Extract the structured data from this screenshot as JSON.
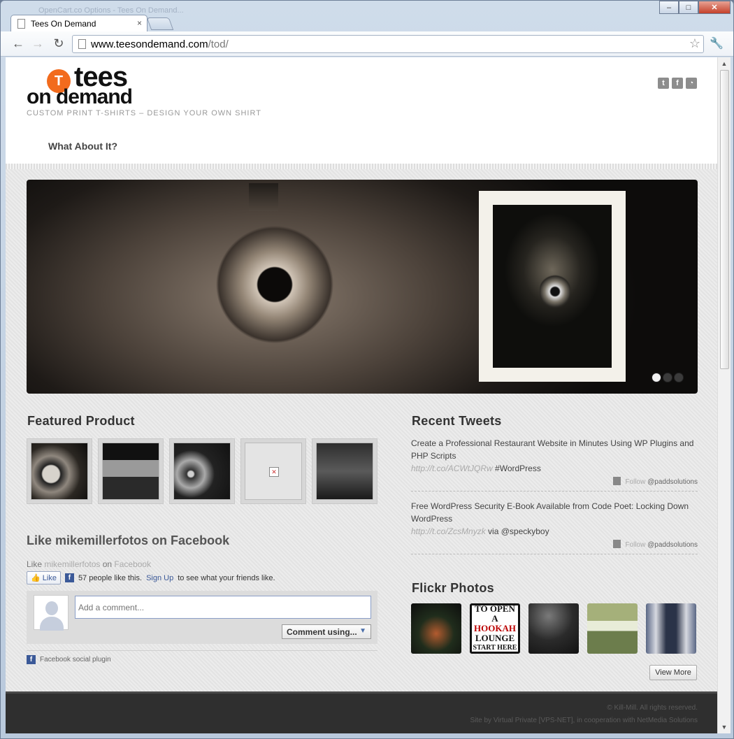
{
  "browser": {
    "ghost_tab_label": "OpenCart.co Options - Tees On Demand...",
    "tab_title": "Tees On Demand",
    "tab_close": "×",
    "url_host": "www.teesondemand.com",
    "url_path": "/tod/",
    "window_buttons": {
      "minimize": "–",
      "maximize": "□",
      "close": "✕"
    }
  },
  "site": {
    "logo_letter": "T",
    "logo_word1": "tees",
    "logo_word2": "on demand",
    "tagline": "CUSTOM PRINT T-SHIRTS – DESIGN YOUR OWN SHIRT",
    "social_icons": [
      "twitter-icon",
      "facebook-icon",
      "rss-icon"
    ],
    "social_glyphs": [
      "t",
      "f",
      "◔"
    ],
    "nav": {
      "about": "What About It?"
    }
  },
  "slider": {
    "dots_count": 3,
    "active_dot": 0
  },
  "featured": {
    "title": "Featured Product"
  },
  "facebook": {
    "title": "Like mikemillerfotos on Facebook",
    "like_prefix": "Like ",
    "page_link": "mikemillerfotos",
    "like_on": " on ",
    "fb_link": "Facebook",
    "like_button": "👍 Like",
    "count_text": "57 people like this.",
    "signup": "Sign Up",
    "signup_suffix": "to see what your friends like.",
    "comment_placeholder": "Add a comment...",
    "comment_using": "Comment using...",
    "plugin_label": "Facebook social plugin"
  },
  "tweets": {
    "title": "Recent Tweets",
    "items": [
      {
        "text": "Create a Professional Restaurant Website in Minutes Using WP Plugins and PHP Scripts",
        "url": "http://t.co/ACWtJQRw",
        "suffix": " #WordPress",
        "follow": "Follow",
        "handle": "@paddsolutions"
      },
      {
        "text": "Free WordPress Security E-Book Available from Code Poet: Locking Down WordPress",
        "url": "http://t.co/ZcsMnyzk",
        "suffix": " via @speckyboy",
        "follow": "Follow",
        "handle": "@paddsolutions"
      }
    ]
  },
  "flickr": {
    "title": "Flickr Photos",
    "sign_lines": [
      "TO OPEN A",
      "HOOKAH",
      "LOUNGE",
      "START HERE"
    ],
    "view_more": "View More"
  },
  "footer": {
    "line1": "© Kill-Mill. All rights reserved.",
    "line2": "Site by Virtual Private [VPS-NET], in cooperation with NetMedia Solutions"
  },
  "colors": {
    "brand_orange": "#f26b1d",
    "facebook_blue": "#3b5998",
    "footer_bg": "#2f2f2f"
  }
}
